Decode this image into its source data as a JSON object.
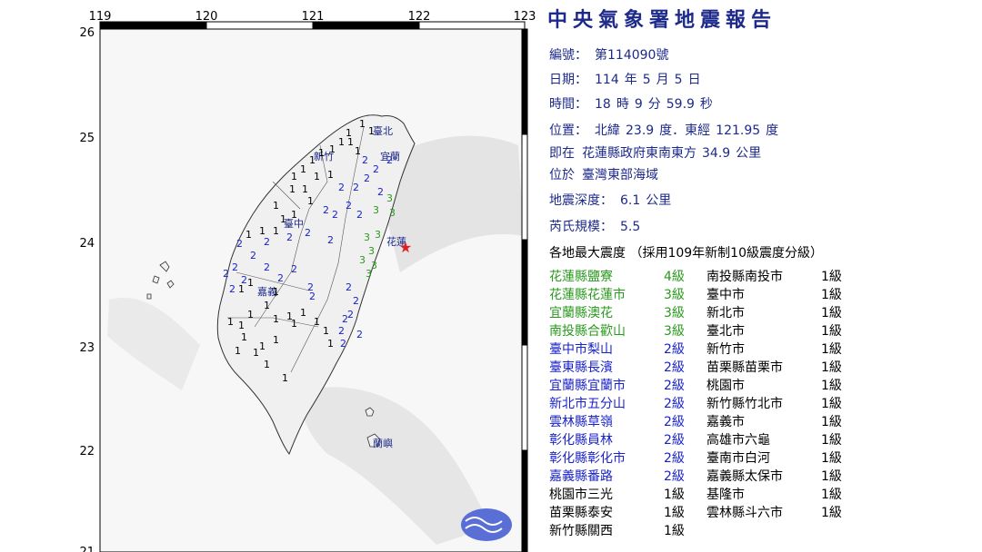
{
  "colors": {
    "title": "#1d2a8a",
    "int1": "#000000",
    "int2": "#1a23c8",
    "int3": "#2a9a1e",
    "int4": "#2a9a1e",
    "epicenter": "#e0201a",
    "land": "#f0f0f0",
    "sea_relief": "#d9d9d9",
    "frame": "#000000"
  },
  "report": {
    "title": "中央氣象署地震報告",
    "number_label": "編號：",
    "number_value": "第114090號",
    "date_label": "日期：",
    "date_year": "114",
    "date_year_unit": "年",
    "date_month": "5",
    "date_month_unit": "月",
    "date_day": "5",
    "date_day_unit": "日",
    "time_label": "時間：",
    "time_hour": "18",
    "time_hour_unit": "時",
    "time_min": "9",
    "time_min_unit": "分",
    "time_sec": "59.9",
    "time_sec_unit": "秒",
    "loc_label": "位置：",
    "loc_lat_label": "北緯",
    "loc_lat": "23.9",
    "loc_lat_unit": "度．東經",
    "loc_lon": "121.95",
    "loc_lon_unit": "度",
    "near_label": "即在",
    "near_text": "花蓮縣政府東南東方",
    "near_dist": "34.9",
    "near_unit": "公里",
    "region_label": "位於",
    "region_text": "臺灣東部海域",
    "depth_label": "地震深度：",
    "depth_value": "6.1",
    "depth_unit": "公里",
    "mag_label": "芮氏規模：",
    "mag_value": "5.5",
    "intensity_header": "各地最大震度 （採用109年新制10級震度分級）"
  },
  "intensities_left": [
    {
      "place": "花蓮縣鹽寮",
      "level": "4級",
      "color": "#2a9a1e"
    },
    {
      "place": "花蓮縣花蓮市",
      "level": "3級",
      "color": "#2a9a1e"
    },
    {
      "place": "宜蘭縣澳花",
      "level": "3級",
      "color": "#2a9a1e"
    },
    {
      "place": "南投縣合歡山",
      "level": "3級",
      "color": "#2a9a1e"
    },
    {
      "place": "臺中市梨山",
      "level": "2級",
      "color": "#1a23c8"
    },
    {
      "place": "臺東縣長濱",
      "level": "2級",
      "color": "#1a23c8"
    },
    {
      "place": "宜蘭縣宜蘭市",
      "level": "2級",
      "color": "#1a23c8"
    },
    {
      "place": "新北市五分山",
      "level": "2級",
      "color": "#1a23c8"
    },
    {
      "place": "雲林縣草嶺",
      "level": "2級",
      "color": "#1a23c8"
    },
    {
      "place": "彰化縣員林",
      "level": "2級",
      "color": "#1a23c8"
    },
    {
      "place": "彰化縣彰化市",
      "level": "2級",
      "color": "#1a23c8"
    },
    {
      "place": "嘉義縣番路",
      "level": "2級",
      "color": "#1a23c8"
    },
    {
      "place": "桃園市三光",
      "level": "1級",
      "color": "#000000"
    },
    {
      "place": "苗栗縣泰安",
      "level": "1級",
      "color": "#000000"
    },
    {
      "place": "新竹縣關西",
      "level": "1級",
      "color": "#000000"
    }
  ],
  "intensities_right": [
    {
      "place": "南投縣南投市",
      "level": "1級",
      "color": "#000000"
    },
    {
      "place": "臺中市",
      "level": "1級",
      "color": "#000000"
    },
    {
      "place": "新北市",
      "level": "1級",
      "color": "#000000"
    },
    {
      "place": "臺北市",
      "level": "1級",
      "color": "#000000"
    },
    {
      "place": "新竹市",
      "level": "1級",
      "color": "#000000"
    },
    {
      "place": "苗栗縣苗栗市",
      "level": "1級",
      "color": "#000000"
    },
    {
      "place": "桃園市",
      "level": "1級",
      "color": "#000000"
    },
    {
      "place": "新竹縣竹北市",
      "level": "1級",
      "color": "#000000"
    },
    {
      "place": "嘉義市",
      "level": "1級",
      "color": "#000000"
    },
    {
      "place": "高雄市六龜",
      "level": "1級",
      "color": "#000000"
    },
    {
      "place": "臺南市白河",
      "level": "1級",
      "color": "#000000"
    },
    {
      "place": "嘉義縣太保市",
      "level": "1級",
      "color": "#000000"
    },
    {
      "place": "基隆市",
      "level": "1級",
      "color": "#000000"
    },
    {
      "place": "雲林縣斗六市",
      "level": "1級",
      "color": "#000000"
    }
  ],
  "map": {
    "lon_ticks": [
      "119",
      "120",
      "121",
      "122",
      "123"
    ],
    "lat_ticks": [
      "26",
      "25",
      "24",
      "23",
      "22",
      "21"
    ],
    "place_labels": [
      "臺北",
      "宜蘭",
      "新竹",
      "臺中",
      "花蓮",
      "嘉義",
      "蘭嶼"
    ],
    "station_values": [
      "1",
      "1",
      "1",
      "1",
      "1",
      "1",
      "1",
      "1",
      "2",
      "2",
      "2",
      "1",
      "1",
      "1",
      "1",
      "1",
      "1",
      "1",
      "2",
      "2",
      "2",
      "2",
      "1",
      "1",
      "1",
      "1",
      "1",
      "2",
      "2",
      "2",
      "2",
      "3",
      "3",
      "3",
      "1",
      "1",
      "2",
      "2",
      "2",
      "2",
      "2",
      "3",
      "3",
      "3",
      "2",
      "2",
      "2",
      "2",
      "2",
      "2",
      "2",
      "3",
      "3",
      "3",
      "2",
      "2",
      "1",
      "1",
      "1",
      "2",
      "2",
      "2",
      "2",
      "2",
      "1",
      "1",
      "1",
      "1",
      "1",
      "1",
      "1",
      "1",
      "1",
      "1",
      "1",
      "1",
      "1",
      "2",
      "2",
      "2",
      "1",
      "1",
      "1",
      "1",
      "1"
    ]
  }
}
